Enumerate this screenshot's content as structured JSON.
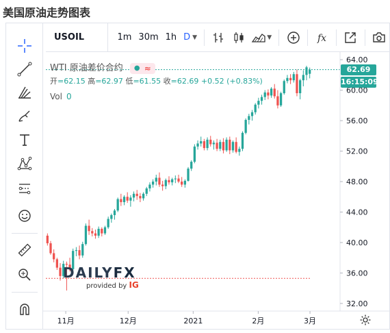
{
  "page": {
    "title": "美国原油走势图表"
  },
  "toolbar": {
    "symbol": "USOIL",
    "timeframes": [
      "1m",
      "30m",
      "1h",
      "D"
    ],
    "active_timeframe": "D",
    "function_glyph": "fx"
  },
  "legend": {
    "name": "WTI 原油差价合约",
    "ohlc_labels": {
      "open": "开",
      "high": "高",
      "low": "低",
      "close": "收"
    },
    "open": "=62.15",
    "high": "=62.97",
    "low": "=61.55",
    "close": "=62.69",
    "change": "+0.52 (+0.83%)",
    "vol_label": "Vol",
    "vol_value": "0"
  },
  "price_tags": {
    "last": "62.69",
    "countdown": "16:15:09"
  },
  "watermark": {
    "brand_part1": "DAILY",
    "brand_part2": "FX",
    "provided_by": "provided by",
    "ig": "IG"
  },
  "colors": {
    "up": "#26a69a",
    "down": "#ef5350",
    "accent": "#2962ff"
  },
  "chart_data": {
    "type": "candlestick",
    "y_ticks": [
      "64.00",
      "60.00",
      "56.00",
      "52.00",
      "48.00",
      "44.00",
      "40.00",
      "36.00",
      "32.00"
    ],
    "ylim": [
      31.0,
      65.0
    ],
    "x_ticks": [
      "11月",
      "12月",
      "2021",
      "2月",
      "3月"
    ],
    "grid": false,
    "reference_line": 35.3,
    "last_price": 62.69,
    "candles": [
      [
        40.9,
        41.2,
        39.6,
        39.9
      ],
      [
        39.9,
        40.2,
        38.4,
        38.6
      ],
      [
        38.6,
        39.1,
        37.4,
        37.8
      ],
      [
        37.8,
        38.0,
        36.4,
        36.7
      ],
      [
        36.7,
        37.3,
        35.0,
        35.6
      ],
      [
        35.6,
        37.6,
        35.3,
        37.2
      ],
      [
        37.2,
        37.5,
        33.7,
        37.1
      ],
      [
        37.1,
        38.0,
        36.2,
        36.5
      ],
      [
        36.5,
        39.2,
        36.3,
        38.9
      ],
      [
        38.9,
        39.4,
        38.2,
        39.0
      ],
      [
        39.0,
        39.6,
        37.8,
        38.3
      ],
      [
        38.3,
        40.1,
        38.0,
        39.8
      ],
      [
        39.8,
        42.5,
        39.6,
        42.2
      ],
      [
        42.2,
        43.0,
        41.0,
        41.5
      ],
      [
        41.5,
        41.9,
        40.8,
        41.2
      ],
      [
        41.2,
        41.7,
        40.5,
        40.9
      ],
      [
        40.9,
        42.1,
        40.6,
        41.8
      ],
      [
        41.8,
        42.0,
        40.8,
        41.2
      ],
      [
        41.2,
        42.2,
        41.0,
        42.0
      ],
      [
        42.0,
        43.4,
        41.8,
        43.1
      ],
      [
        43.1,
        43.8,
        42.6,
        43.6
      ],
      [
        43.6,
        44.4,
        43.0,
        44.2
      ],
      [
        44.2,
        45.9,
        44.0,
        45.7
      ],
      [
        45.7,
        46.4,
        44.8,
        45.3
      ],
      [
        45.3,
        46.2,
        44.9,
        46.0
      ],
      [
        46.0,
        46.6,
        45.2,
        45.5
      ],
      [
        45.5,
        46.2,
        44.7,
        45.9
      ],
      [
        45.9,
        46.7,
        45.4,
        46.4
      ],
      [
        46.4,
        46.9,
        45.6,
        46.1
      ],
      [
        46.1,
        46.5,
        45.3,
        45.8
      ],
      [
        45.8,
        46.6,
        45.5,
        46.4
      ],
      [
        46.4,
        47.3,
        46.1,
        47.1
      ],
      [
        47.1,
        47.9,
        46.7,
        47.6
      ],
      [
        47.6,
        48.3,
        47.2,
        48.0
      ],
      [
        48.0,
        48.9,
        47.5,
        48.5
      ],
      [
        48.5,
        49.2,
        47.3,
        47.6
      ],
      [
        47.6,
        48.1,
        46.8,
        47.4
      ],
      [
        47.4,
        48.4,
        47.0,
        48.2
      ],
      [
        48.2,
        48.7,
        47.6,
        47.9
      ],
      [
        47.9,
        48.5,
        47.5,
        48.3
      ],
      [
        48.3,
        48.8,
        47.8,
        48.4
      ],
      [
        48.4,
        48.9,
        47.8,
        48.0
      ],
      [
        48.0,
        48.6,
        47.3,
        47.6
      ],
      [
        47.6,
        48.3,
        47.2,
        48.1
      ],
      [
        48.1,
        49.9,
        48.0,
        49.7
      ],
      [
        49.7,
        50.8,
        49.4,
        50.6
      ],
      [
        50.6,
        52.9,
        50.4,
        52.6
      ],
      [
        52.6,
        53.4,
        52.2,
        53.0
      ],
      [
        53.0,
        53.9,
        52.6,
        53.3
      ],
      [
        53.3,
        53.6,
        52.1,
        52.4
      ],
      [
        52.4,
        53.8,
        52.1,
        53.5
      ],
      [
        53.5,
        54.0,
        52.6,
        52.9
      ],
      [
        52.9,
        53.4,
        52.2,
        53.1
      ],
      [
        53.1,
        53.6,
        52.0,
        52.3
      ],
      [
        52.3,
        53.5,
        52.0,
        53.2
      ],
      [
        53.2,
        53.7,
        51.7,
        52.1
      ],
      [
        52.1,
        53.8,
        51.9,
        53.5
      ],
      [
        53.5,
        53.9,
        51.6,
        52.1
      ],
      [
        52.1,
        53.4,
        51.8,
        53.2
      ],
      [
        53.2,
        53.8,
        51.7,
        51.9
      ],
      [
        51.9,
        52.6,
        51.4,
        52.3
      ],
      [
        52.3,
        54.6,
        52.0,
        54.4
      ],
      [
        54.4,
        56.3,
        54.2,
        56.1
      ],
      [
        56.1,
        56.9,
        55.5,
        56.6
      ],
      [
        56.6,
        57.4,
        56.0,
        57.1
      ],
      [
        57.1,
        58.3,
        56.8,
        58.1
      ],
      [
        58.1,
        59.0,
        57.6,
        58.6
      ],
      [
        58.6,
        59.4,
        58.1,
        59.1
      ],
      [
        59.1,
        60.0,
        58.7,
        59.7
      ],
      [
        59.7,
        60.1,
        58.8,
        59.3
      ],
      [
        59.3,
        60.4,
        59.0,
        60.2
      ],
      [
        60.2,
        60.8,
        58.9,
        59.2
      ],
      [
        59.2,
        60.0,
        57.6,
        58.0
      ],
      [
        58.0,
        59.8,
        57.8,
        59.6
      ],
      [
        59.6,
        61.4,
        59.4,
        61.2
      ],
      [
        61.2,
        62.0,
        60.9,
        61.6
      ],
      [
        61.6,
        62.1,
        60.8,
        61.3
      ],
      [
        61.3,
        62.4,
        61.0,
        62.1
      ],
      [
        62.1,
        62.7,
        59.2,
        59.6
      ],
      [
        59.6,
        61.5,
        58.8,
        61.3
      ],
      [
        61.3,
        62.6,
        60.5,
        62.0
      ],
      [
        62.0,
        63.2,
        61.3,
        63.0
      ],
      [
        62.15,
        62.97,
        61.55,
        62.69
      ]
    ]
  }
}
